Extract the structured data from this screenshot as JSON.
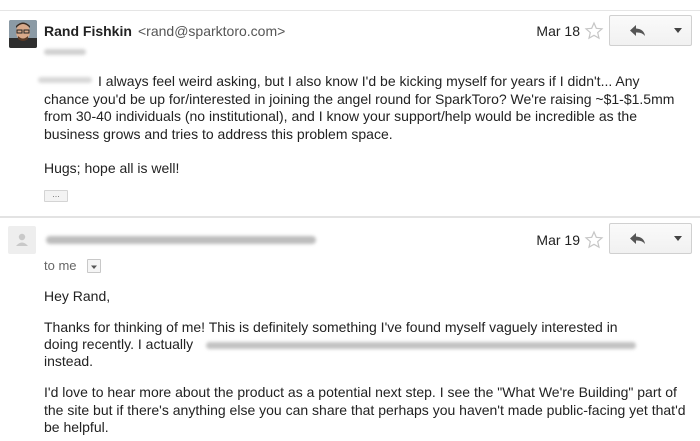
{
  "messages": [
    {
      "sender_name": "Rand Fishkin",
      "sender_email": "<rand@sparktoro.com>",
      "date": "Mar 18",
      "paragraphs": [
        "I always feel weird asking, but I also know I'd be kicking myself for years if I didn't... Any chance you'd be up for/interested in joining the angel round for SparkToro? We're raising ~$1-$1.5mm from 30-40 individuals (no institutional), and I know your support/help would be incredible as the business grows and tries to address this problem space.",
        "Hugs; hope all is well!"
      ],
      "ellipsis": "..."
    },
    {
      "date": "Mar 19",
      "to_label": "to me",
      "greeting": "Hey Rand,",
      "para1_line1": "Thanks for thinking of me! This is definitely something I've found myself vaguely interested in",
      "para1_line2": "doing recently. I actually",
      "para1_line3": "instead.",
      "para2": "I'd love to hear more about the product as a potential next step. I see the \"What We're Building\" part of the site but if there's anything else you can share that perhaps you haven't made public-facing yet that'd be helpful."
    }
  ],
  "icons": {
    "star": "star-outline-icon",
    "reply": "reply-arrow-icon",
    "more": "dropdown-caret-icon"
  }
}
